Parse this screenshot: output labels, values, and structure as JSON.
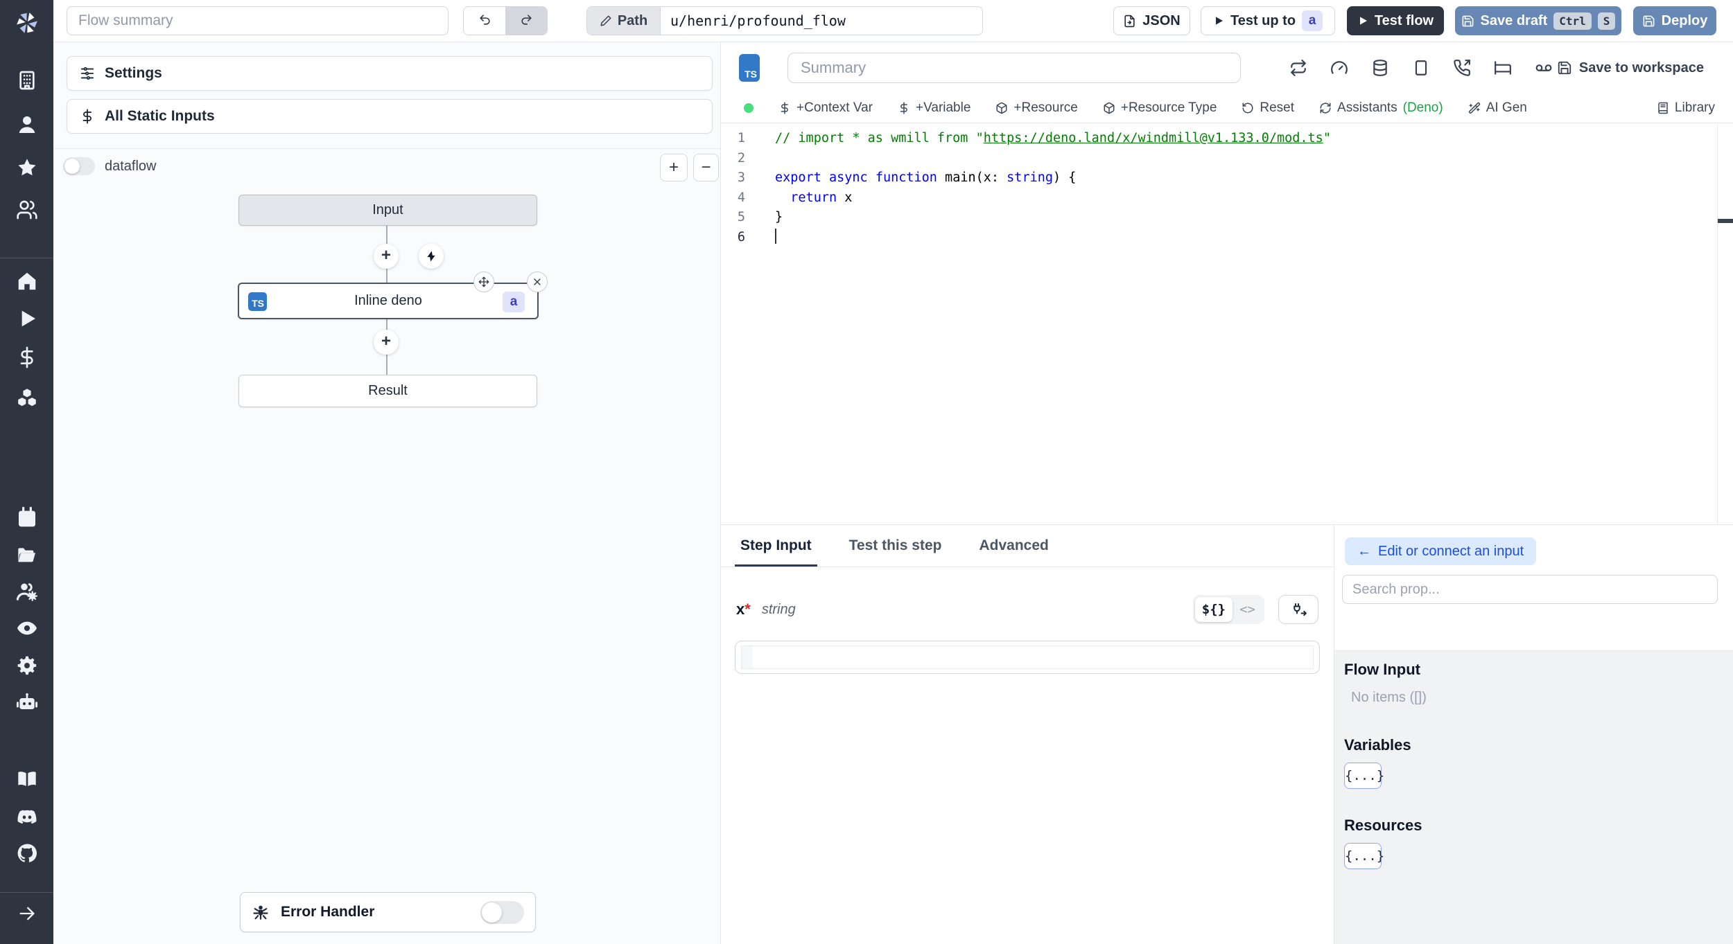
{
  "topbar": {
    "flow_summary_placeholder": "Flow summary",
    "path_label": "Path",
    "path_value": "u/henri/profound_flow",
    "json_label": "JSON",
    "test_up_to_label": "Test up to",
    "test_up_to_badge": "a",
    "test_flow_label": "Test flow",
    "save_draft_label": "Save draft",
    "save_draft_keys": [
      "Ctrl",
      "S"
    ],
    "deploy_label": "Deploy"
  },
  "sidebar": {
    "groups": [
      {
        "icons": [
          "building",
          "user",
          "star",
          "users"
        ]
      },
      {
        "icons": [
          "home",
          "play",
          "dollar",
          "cubes"
        ]
      },
      {
        "icons": [
          "calendar",
          "folder-open",
          "users-gear",
          "eye",
          "gear",
          "robot"
        ]
      },
      {
        "icons": [
          "book-open",
          "discord",
          "github"
        ]
      }
    ],
    "expand_icon": "arrow-right"
  },
  "flow_panel": {
    "settings_label": "Settings",
    "static_inputs_label": "All Static Inputs",
    "dataflow_label": "dataflow",
    "zoom_in_label": "+",
    "zoom_out_label": "−",
    "input_node_label": "Input",
    "step_node": {
      "lang_badge": "TS",
      "title": "Inline deno",
      "id_badge": "a"
    },
    "result_node_label": "Result",
    "error_handler_label": "Error Handler"
  },
  "editor": {
    "lang_badge": "TS",
    "summary_placeholder": "Summary",
    "header_icons": [
      "repeat",
      "gauge",
      "database",
      "square",
      "phone-incoming",
      "bed",
      "voicemail"
    ],
    "save_to_workspace_label": "Save to workspace",
    "toolbar": [
      {
        "icon": "dollar",
        "label": "+Context Var"
      },
      {
        "icon": "dollar",
        "label": "+Variable"
      },
      {
        "icon": "package",
        "label": "+Resource"
      },
      {
        "icon": "package",
        "label": "+Resource Type"
      },
      {
        "icon": "rotate-ccw",
        "label": "Reset"
      },
      {
        "icon": "refresh-cw",
        "label": "Assistants",
        "suffix": "(Deno)"
      },
      {
        "icon": "wand",
        "label": "AI Gen"
      }
    ],
    "library_label": "Library",
    "code_lines": [
      {
        "n": "1",
        "tokens": [
          {
            "c": "comment",
            "t": "// import * as wmill from \""
          },
          {
            "c": "comment-link",
            "t": "https://deno.land/x/windmill@v1.133.0/mod.ts"
          },
          {
            "c": "comment",
            "t": "\""
          }
        ]
      },
      {
        "n": "2",
        "tokens": []
      },
      {
        "n": "3",
        "tokens": [
          {
            "c": "kw",
            "t": "export"
          },
          {
            "c": "plain",
            "t": " "
          },
          {
            "c": "kw",
            "t": "async"
          },
          {
            "c": "plain",
            "t": " "
          },
          {
            "c": "kw",
            "t": "function"
          },
          {
            "c": "plain",
            "t": " main(x: "
          },
          {
            "c": "kw",
            "t": "string"
          },
          {
            "c": "plain",
            "t": ") {"
          }
        ]
      },
      {
        "n": "4",
        "tokens": [
          {
            "c": "plain",
            "t": "  "
          },
          {
            "c": "kw",
            "t": "return"
          },
          {
            "c": "plain",
            "t": " x"
          }
        ]
      },
      {
        "n": "5",
        "tokens": [
          {
            "c": "plain",
            "t": "}"
          }
        ]
      },
      {
        "n": "6",
        "tokens": [],
        "cursor": true
      }
    ]
  },
  "step_panel": {
    "tabs": [
      {
        "label": "Step Input",
        "active": true
      },
      {
        "label": "Test this step",
        "active": false
      },
      {
        "label": "Advanced",
        "active": false
      }
    ],
    "arg_name": "x",
    "required_marker": "*",
    "arg_type": "string",
    "expr_toggle_label": "${}",
    "code_toggle_label": "<>",
    "input_value": ""
  },
  "connect_panel": {
    "back_arrow": "←",
    "edit_button_label": "Edit or connect an input",
    "search_placeholder": "Search prop...",
    "flow_input_title": "Flow Input",
    "flow_input_empty": "No items ([])",
    "variables_title": "Variables",
    "variables_button": "{...}",
    "resources_title": "Resources",
    "resources_button": "{...}"
  },
  "colors": {
    "rail_dark": "#2e3440",
    "typescript_blue": "#3178c6",
    "steel_blue": "#6787b4",
    "badge_bg": "#dfe3fc",
    "badge_text": "#3f3fb8",
    "status_green": "#4ade80",
    "deno_green": "#16a34a",
    "connect_btn_bg": "#dbeafe",
    "connect_btn_text": "#1d4ed8"
  }
}
